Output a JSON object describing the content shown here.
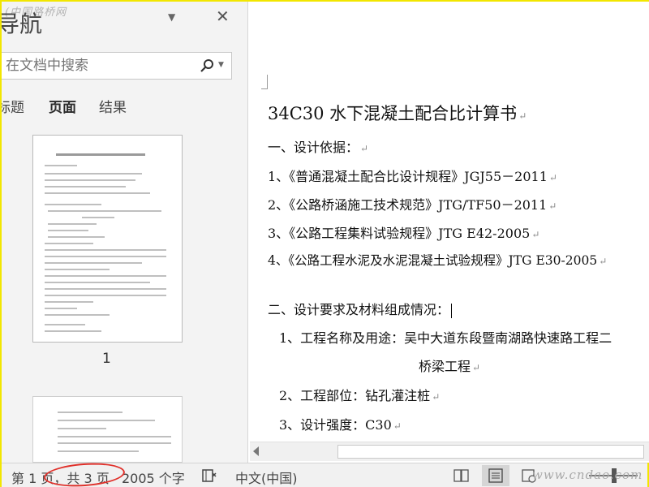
{
  "watermarks": {
    "top": "(中国路桥网",
    "bottom": "www.cndao.com"
  },
  "nav": {
    "title": "导航",
    "search_placeholder": "在文档中搜索",
    "tabs": [
      {
        "label": "标题"
      },
      {
        "label": "页面"
      },
      {
        "label": "结果"
      }
    ],
    "thumbnail_page_number": "1"
  },
  "document": {
    "title": "34C30 水下混凝土配合比计算书",
    "lines": [
      "一、设计依据：",
      "1、《普通混凝土配合比设计规程》JGJ55－2011",
      "2、《公路桥涵施工技术规范》JTG/TF50－2011",
      "3、《公路工程集料试验规程》JTG E42-2005",
      "4、《公路工程水泥及水泥混凝土试验规程》JTG E30-2005",
      "二、设计要求及材料组成情况：",
      "1、工程名称及用途：吴中大道东段暨南湖路快速路工程二",
      "桥梁工程",
      "2、工程部位：钻孔灌注桩",
      "3、设计强度：C30"
    ],
    "paragraph_mark": "↵"
  },
  "status_bar": {
    "page_info": "第 1 页，共 3 页",
    "word_count": "2005 个字",
    "language": "中文(中国)"
  },
  "annotation_color": "#e0302a"
}
